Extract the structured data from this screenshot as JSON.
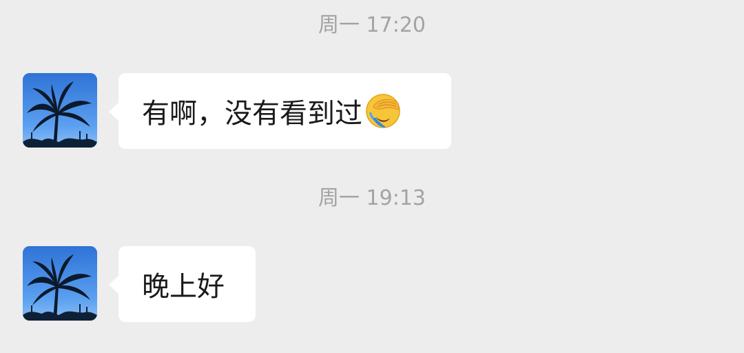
{
  "messages": [
    {
      "timestamp": "周一 17:20",
      "text": "有啊，没有看到过",
      "emoji_icon": "face-palm-crying-emoji"
    },
    {
      "timestamp": "周一 19:13",
      "text": "晚上好"
    }
  ],
  "colors": {
    "background": "#ededed",
    "bubble": "#ffffff",
    "timestamp": "#a3a3a3",
    "avatar_sky": "#3f86e0"
  }
}
